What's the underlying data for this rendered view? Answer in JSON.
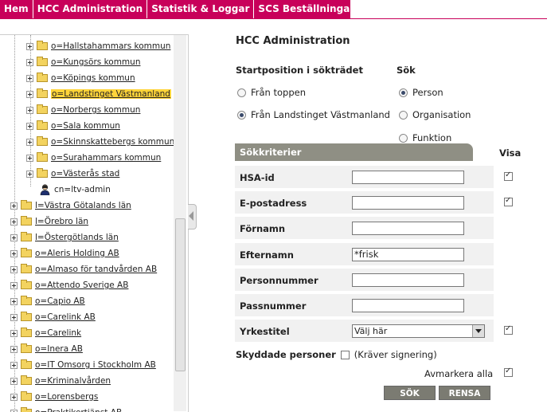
{
  "nav": {
    "items": [
      "Hem",
      "HCC Administration",
      "Statistik & Loggar",
      "SCS Beställningar"
    ]
  },
  "tree": {
    "items": [
      {
        "label": "o=Hallstahammars kommun",
        "level": 2,
        "selected": false,
        "kind": "folder"
      },
      {
        "label": "o=Kungsörs kommun",
        "level": 2,
        "selected": false,
        "kind": "folder"
      },
      {
        "label": "o=Köpings kommun",
        "level": 2,
        "selected": false,
        "kind": "folder"
      },
      {
        "label": "o=Landstinget Västmanland",
        "level": 2,
        "selected": true,
        "kind": "folder"
      },
      {
        "label": "o=Norbergs kommun",
        "level": 2,
        "selected": false,
        "kind": "folder"
      },
      {
        "label": "o=Sala kommun",
        "level": 2,
        "selected": false,
        "kind": "folder"
      },
      {
        "label": "o=Skinnskattebergs kommun",
        "level": 2,
        "selected": false,
        "kind": "folder"
      },
      {
        "label": "o=Surahammars kommun",
        "level": 2,
        "selected": false,
        "kind": "folder"
      },
      {
        "label": "o=Västerås stad",
        "level": 2,
        "selected": false,
        "kind": "folder"
      },
      {
        "label": "cn=ltv-admin",
        "level": 2,
        "selected": false,
        "kind": "person"
      },
      {
        "label": "l=Västra Götalands län",
        "level": 1,
        "selected": false,
        "kind": "folder"
      },
      {
        "label": "l=Örebro län",
        "level": 1,
        "selected": false,
        "kind": "folder"
      },
      {
        "label": "l=Östergötlands län",
        "level": 1,
        "selected": false,
        "kind": "folder"
      },
      {
        "label": "o=Aleris Holding AB",
        "level": 1,
        "selected": false,
        "kind": "folder"
      },
      {
        "label": "o=Almaso för tandvården AB",
        "level": 1,
        "selected": false,
        "kind": "folder"
      },
      {
        "label": "o=Attendo Sverige AB",
        "level": 1,
        "selected": false,
        "kind": "folder"
      },
      {
        "label": "o=Capio AB",
        "level": 1,
        "selected": false,
        "kind": "folder"
      },
      {
        "label": "o=Carelink AB",
        "level": 1,
        "selected": false,
        "kind": "folder"
      },
      {
        "label": "o=Carelink",
        "level": 1,
        "selected": false,
        "kind": "folder"
      },
      {
        "label": "o=Inera AB",
        "level": 1,
        "selected": false,
        "kind": "folder"
      },
      {
        "label": "o=IT Omsorg i Stockholm AB",
        "level": 1,
        "selected": false,
        "kind": "folder"
      },
      {
        "label": "o=Kriminalvården",
        "level": 1,
        "selected": false,
        "kind": "folder"
      },
      {
        "label": "o=Lorensbergs",
        "level": 1,
        "selected": false,
        "kind": "folder"
      },
      {
        "label": "o=Praktikertjänst AB",
        "level": 1,
        "selected": false,
        "kind": "folder"
      }
    ]
  },
  "main": {
    "title": "HCC Administration",
    "start": {
      "label": "Startposition i sökträdet",
      "options": [
        "Från toppen",
        "Från Landstinget Västmanland"
      ],
      "selected": 1
    },
    "search": {
      "label": "Sök",
      "options": [
        "Person",
        "Organisation",
        "Funktion"
      ],
      "selected": 0
    },
    "criteria_header": "Sökkriterier",
    "visa_label": "Visa",
    "fields": [
      {
        "label": "HSA-id",
        "value": "",
        "type": "input",
        "visa": true
      },
      {
        "label": "E-postadress",
        "value": "",
        "type": "input",
        "visa": true
      },
      {
        "label": "Förnamn",
        "value": "",
        "type": "input",
        "visa": null
      },
      {
        "label": "Efternamn",
        "value": "*frisk",
        "type": "input",
        "visa": null
      },
      {
        "label": "Personnummer",
        "value": "",
        "type": "input",
        "visa": null
      },
      {
        "label": "Passnummer",
        "value": "",
        "type": "input",
        "visa": null
      },
      {
        "label": "Yrkestitel",
        "value": "Välj här",
        "type": "select",
        "visa": true
      }
    ],
    "skyddade": {
      "label": "Skyddade personer",
      "checked": false,
      "note": "(Kräver signering)"
    },
    "avmarkera": {
      "label": "Avmarkera alla",
      "checked": true
    },
    "buttons": {
      "search": "SÖK",
      "clear": "RENSA"
    }
  }
}
